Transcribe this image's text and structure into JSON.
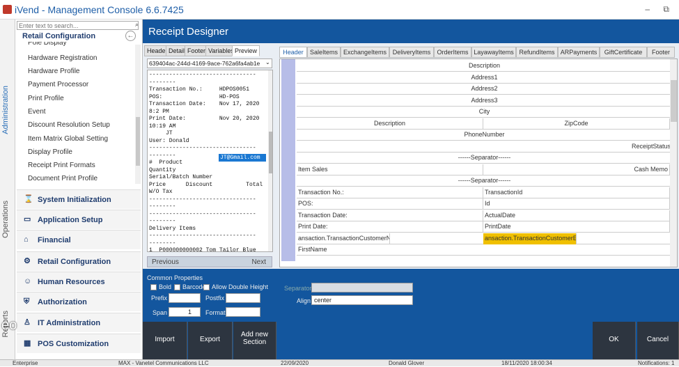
{
  "app_title": "iVend - Management Console  6.6.7425",
  "window_controls": "–  ⧉",
  "vtabs": [
    "Administration",
    "Operations",
    "Reports"
  ],
  "search_placeholder": "Enter text to search...",
  "section_title": "Retail Configuration",
  "nav_items": [
    "Pole Display",
    "Hardware Registration",
    "Hardware Profile",
    "Payment Processor",
    "Print Profile",
    "Event",
    "Discount Resolution Setup",
    "Item Matrix Global Setting",
    "Display Profile",
    "Receipt Print Formats",
    "Document Print Profile"
  ],
  "nav_groups": [
    "System Initialization",
    "Application Setup",
    "Financial",
    "Retail Configuration",
    "Human Resources",
    "Authorization",
    "IT Administration",
    "POS Customization"
  ],
  "page_title": "Receipt Designer",
  "sub_tabs": [
    "Header",
    "Detail",
    "Footer",
    "Variables",
    "Preview"
  ],
  "guid": "639404ac-244d-4169-9ace-762a6fa4ab1e",
  "preview_text": "--------------------------------\n--------\nTransaction No.:     HDPOS0051\nPOS:                 HD-POS\nTransaction Date:    Nov 17, 2020\n8:2 PM\nPrint Date:          Nov 20, 2020\n10:19 AM\n     JT\nUser: Donald\n--------------------------------\n--------\n#  Product\nQuantity\nSerial/Batch Number\nPrice      Discount          Total\nW/O Tax\n--------------------------------\n--------\n--------------------------------\n--------\nDelivery Items\n--------------------------------\n--------\n1  P000000000002 Tom Tailor Blue\nStriped Regular Fit Polo T-Shirt",
  "preview_highlight": "JT@Gmail.com",
  "prev_label": "Previous",
  "next_label": "Next",
  "designer_tabs": [
    "Header",
    "SaleItems",
    "ExchangeItems",
    "DeliveryItems",
    "OrderItems",
    "LayawayItems",
    "RefundItems",
    "ARPayments",
    "GiftCertificate",
    "Footer"
  ],
  "grid_rows": [
    {
      "cells": [
        {
          "t": "Description",
          "c": 1
        }
      ]
    },
    {
      "cells": [
        {
          "t": "Address1",
          "c": 1
        }
      ]
    },
    {
      "cells": [
        {
          "t": "Address2",
          "c": 1
        }
      ]
    },
    {
      "cells": [
        {
          "t": "Address3",
          "c": 1
        }
      ]
    },
    {
      "cells": [
        {
          "t": "City",
          "c": 1
        }
      ]
    },
    {
      "cells": [
        {
          "t": "Description",
          "c": 1
        },
        {
          "t": "ZipCode",
          "c": 1
        }
      ]
    },
    {
      "cells": [
        {
          "t": "PhoneNumber",
          "c": 1
        }
      ]
    },
    {
      "cells": [
        {
          "t": "ReceiptStatus",
          "c": 2
        }
      ]
    },
    {
      "cells": [
        {
          "t": "------Separator------",
          "c": 1
        }
      ]
    },
    {
      "cells": [
        {
          "t": "Item Sales",
          "c": 0
        },
        {
          "t": "Cash Memo",
          "c": 2
        }
      ]
    },
    {
      "cells": [
        {
          "t": "------Separator------",
          "c": 1
        }
      ]
    },
    {
      "cells": [
        {
          "t": "Transaction No.:",
          "c": 0
        },
        {
          "t": "TransactionId",
          "c": 0
        }
      ]
    },
    {
      "cells": [
        {
          "t": "POS:",
          "c": 0
        },
        {
          "t": "Id",
          "c": 0
        }
      ]
    },
    {
      "cells": [
        {
          "t": "Transaction Date:",
          "c": 0
        },
        {
          "t": "ActualDate",
          "c": 0
        }
      ]
    },
    {
      "cells": [
        {
          "t": "Print Date:",
          "c": 0
        },
        {
          "t": "PrintDate",
          "c": 0
        }
      ]
    },
    {
      "cells": [
        {
          "t": "ansaction.TransactionCustomerName",
          "c": 0
        },
        {
          "t": "ansaction.TransactionCustomerEmail",
          "c": 0
        }
      ]
    },
    {
      "cells": [
        {
          "t": "FirstName",
          "c": 0
        }
      ]
    }
  ],
  "props": {
    "title": "Common Properties",
    "bold": "Bold",
    "barcode": "Barcode",
    "allow_double_height": "Allow Double Height",
    "prefix": "Prefix",
    "postfix": "Postfix",
    "span": "Span",
    "span_value": "1",
    "format": "Format",
    "separator": "Separator",
    "align": "Align",
    "align_value": "center"
  },
  "buttons": {
    "import": "Import",
    "export": "Export",
    "add_line1": "Add new",
    "add_line2": "Section",
    "ok": "OK",
    "cancel": "Cancel"
  },
  "status": {
    "edition": "Enterprise",
    "company": "MAX - Vanetel Communications LLC",
    "date": "22/09/2020",
    "user": "Donald Glover",
    "datetime": "18/11/2020 18:00:34",
    "notifications": "Notifications: 1"
  },
  "overlay_text": "eo",
  "colors": {
    "brand": "#13569e",
    "highlight": "#f0c000",
    "selection": "#1a78d2"
  }
}
